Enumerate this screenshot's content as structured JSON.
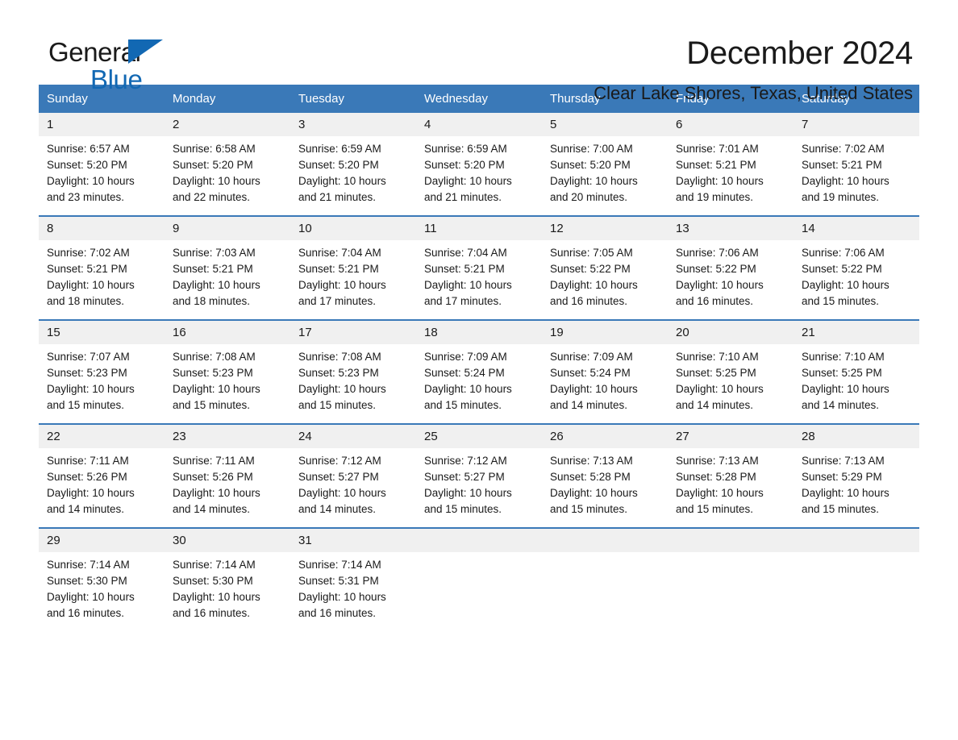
{
  "brand": {
    "name_part1": "General",
    "name_part2": "Blue",
    "accent_color": "#1268b3"
  },
  "header": {
    "month_title": "December 2024",
    "location": "Clear Lake Shores, Texas, United States"
  },
  "theme": {
    "header_bar_color": "#3a79b8",
    "daynum_bg": "#f0f0f0",
    "text_color": "#1a1a1a"
  },
  "calendar": {
    "weekday_headers": [
      "Sunday",
      "Monday",
      "Tuesday",
      "Wednesday",
      "Thursday",
      "Friday",
      "Saturday"
    ],
    "weeks": [
      [
        {
          "day": "1",
          "sunrise": "Sunrise: 6:57 AM",
          "sunset": "Sunset: 5:20 PM",
          "daylight_line1": "Daylight: 10 hours",
          "daylight_line2": "and 23 minutes."
        },
        {
          "day": "2",
          "sunrise": "Sunrise: 6:58 AM",
          "sunset": "Sunset: 5:20 PM",
          "daylight_line1": "Daylight: 10 hours",
          "daylight_line2": "and 22 minutes."
        },
        {
          "day": "3",
          "sunrise": "Sunrise: 6:59 AM",
          "sunset": "Sunset: 5:20 PM",
          "daylight_line1": "Daylight: 10 hours",
          "daylight_line2": "and 21 minutes."
        },
        {
          "day": "4",
          "sunrise": "Sunrise: 6:59 AM",
          "sunset": "Sunset: 5:20 PM",
          "daylight_line1": "Daylight: 10 hours",
          "daylight_line2": "and 21 minutes."
        },
        {
          "day": "5",
          "sunrise": "Sunrise: 7:00 AM",
          "sunset": "Sunset: 5:20 PM",
          "daylight_line1": "Daylight: 10 hours",
          "daylight_line2": "and 20 minutes."
        },
        {
          "day": "6",
          "sunrise": "Sunrise: 7:01 AM",
          "sunset": "Sunset: 5:21 PM",
          "daylight_line1": "Daylight: 10 hours",
          "daylight_line2": "and 19 minutes."
        },
        {
          "day": "7",
          "sunrise": "Sunrise: 7:02 AM",
          "sunset": "Sunset: 5:21 PM",
          "daylight_line1": "Daylight: 10 hours",
          "daylight_line2": "and 19 minutes."
        }
      ],
      [
        {
          "day": "8",
          "sunrise": "Sunrise: 7:02 AM",
          "sunset": "Sunset: 5:21 PM",
          "daylight_line1": "Daylight: 10 hours",
          "daylight_line2": "and 18 minutes."
        },
        {
          "day": "9",
          "sunrise": "Sunrise: 7:03 AM",
          "sunset": "Sunset: 5:21 PM",
          "daylight_line1": "Daylight: 10 hours",
          "daylight_line2": "and 18 minutes."
        },
        {
          "day": "10",
          "sunrise": "Sunrise: 7:04 AM",
          "sunset": "Sunset: 5:21 PM",
          "daylight_line1": "Daylight: 10 hours",
          "daylight_line2": "and 17 minutes."
        },
        {
          "day": "11",
          "sunrise": "Sunrise: 7:04 AM",
          "sunset": "Sunset: 5:21 PM",
          "daylight_line1": "Daylight: 10 hours",
          "daylight_line2": "and 17 minutes."
        },
        {
          "day": "12",
          "sunrise": "Sunrise: 7:05 AM",
          "sunset": "Sunset: 5:22 PM",
          "daylight_line1": "Daylight: 10 hours",
          "daylight_line2": "and 16 minutes."
        },
        {
          "day": "13",
          "sunrise": "Sunrise: 7:06 AM",
          "sunset": "Sunset: 5:22 PM",
          "daylight_line1": "Daylight: 10 hours",
          "daylight_line2": "and 16 minutes."
        },
        {
          "day": "14",
          "sunrise": "Sunrise: 7:06 AM",
          "sunset": "Sunset: 5:22 PM",
          "daylight_line1": "Daylight: 10 hours",
          "daylight_line2": "and 15 minutes."
        }
      ],
      [
        {
          "day": "15",
          "sunrise": "Sunrise: 7:07 AM",
          "sunset": "Sunset: 5:23 PM",
          "daylight_line1": "Daylight: 10 hours",
          "daylight_line2": "and 15 minutes."
        },
        {
          "day": "16",
          "sunrise": "Sunrise: 7:08 AM",
          "sunset": "Sunset: 5:23 PM",
          "daylight_line1": "Daylight: 10 hours",
          "daylight_line2": "and 15 minutes."
        },
        {
          "day": "17",
          "sunrise": "Sunrise: 7:08 AM",
          "sunset": "Sunset: 5:23 PM",
          "daylight_line1": "Daylight: 10 hours",
          "daylight_line2": "and 15 minutes."
        },
        {
          "day": "18",
          "sunrise": "Sunrise: 7:09 AM",
          "sunset": "Sunset: 5:24 PM",
          "daylight_line1": "Daylight: 10 hours",
          "daylight_line2": "and 15 minutes."
        },
        {
          "day": "19",
          "sunrise": "Sunrise: 7:09 AM",
          "sunset": "Sunset: 5:24 PM",
          "daylight_line1": "Daylight: 10 hours",
          "daylight_line2": "and 14 minutes."
        },
        {
          "day": "20",
          "sunrise": "Sunrise: 7:10 AM",
          "sunset": "Sunset: 5:25 PM",
          "daylight_line1": "Daylight: 10 hours",
          "daylight_line2": "and 14 minutes."
        },
        {
          "day": "21",
          "sunrise": "Sunrise: 7:10 AM",
          "sunset": "Sunset: 5:25 PM",
          "daylight_line1": "Daylight: 10 hours",
          "daylight_line2": "and 14 minutes."
        }
      ],
      [
        {
          "day": "22",
          "sunrise": "Sunrise: 7:11 AM",
          "sunset": "Sunset: 5:26 PM",
          "daylight_line1": "Daylight: 10 hours",
          "daylight_line2": "and 14 minutes."
        },
        {
          "day": "23",
          "sunrise": "Sunrise: 7:11 AM",
          "sunset": "Sunset: 5:26 PM",
          "daylight_line1": "Daylight: 10 hours",
          "daylight_line2": "and 14 minutes."
        },
        {
          "day": "24",
          "sunrise": "Sunrise: 7:12 AM",
          "sunset": "Sunset: 5:27 PM",
          "daylight_line1": "Daylight: 10 hours",
          "daylight_line2": "and 14 minutes."
        },
        {
          "day": "25",
          "sunrise": "Sunrise: 7:12 AM",
          "sunset": "Sunset: 5:27 PM",
          "daylight_line1": "Daylight: 10 hours",
          "daylight_line2": "and 15 minutes."
        },
        {
          "day": "26",
          "sunrise": "Sunrise: 7:13 AM",
          "sunset": "Sunset: 5:28 PM",
          "daylight_line1": "Daylight: 10 hours",
          "daylight_line2": "and 15 minutes."
        },
        {
          "day": "27",
          "sunrise": "Sunrise: 7:13 AM",
          "sunset": "Sunset: 5:28 PM",
          "daylight_line1": "Daylight: 10 hours",
          "daylight_line2": "and 15 minutes."
        },
        {
          "day": "28",
          "sunrise": "Sunrise: 7:13 AM",
          "sunset": "Sunset: 5:29 PM",
          "daylight_line1": "Daylight: 10 hours",
          "daylight_line2": "and 15 minutes."
        }
      ],
      [
        {
          "day": "29",
          "sunrise": "Sunrise: 7:14 AM",
          "sunset": "Sunset: 5:30 PM",
          "daylight_line1": "Daylight: 10 hours",
          "daylight_line2": "and 16 minutes."
        },
        {
          "day": "30",
          "sunrise": "Sunrise: 7:14 AM",
          "sunset": "Sunset: 5:30 PM",
          "daylight_line1": "Daylight: 10 hours",
          "daylight_line2": "and 16 minutes."
        },
        {
          "day": "31",
          "sunrise": "Sunrise: 7:14 AM",
          "sunset": "Sunset: 5:31 PM",
          "daylight_line1": "Daylight: 10 hours",
          "daylight_line2": "and 16 minutes."
        },
        {
          "day": "",
          "sunrise": "",
          "sunset": "",
          "daylight_line1": "",
          "daylight_line2": ""
        },
        {
          "day": "",
          "sunrise": "",
          "sunset": "",
          "daylight_line1": "",
          "daylight_line2": ""
        },
        {
          "day": "",
          "sunrise": "",
          "sunset": "",
          "daylight_line1": "",
          "daylight_line2": ""
        },
        {
          "day": "",
          "sunrise": "",
          "sunset": "",
          "daylight_line1": "",
          "daylight_line2": ""
        }
      ]
    ]
  }
}
